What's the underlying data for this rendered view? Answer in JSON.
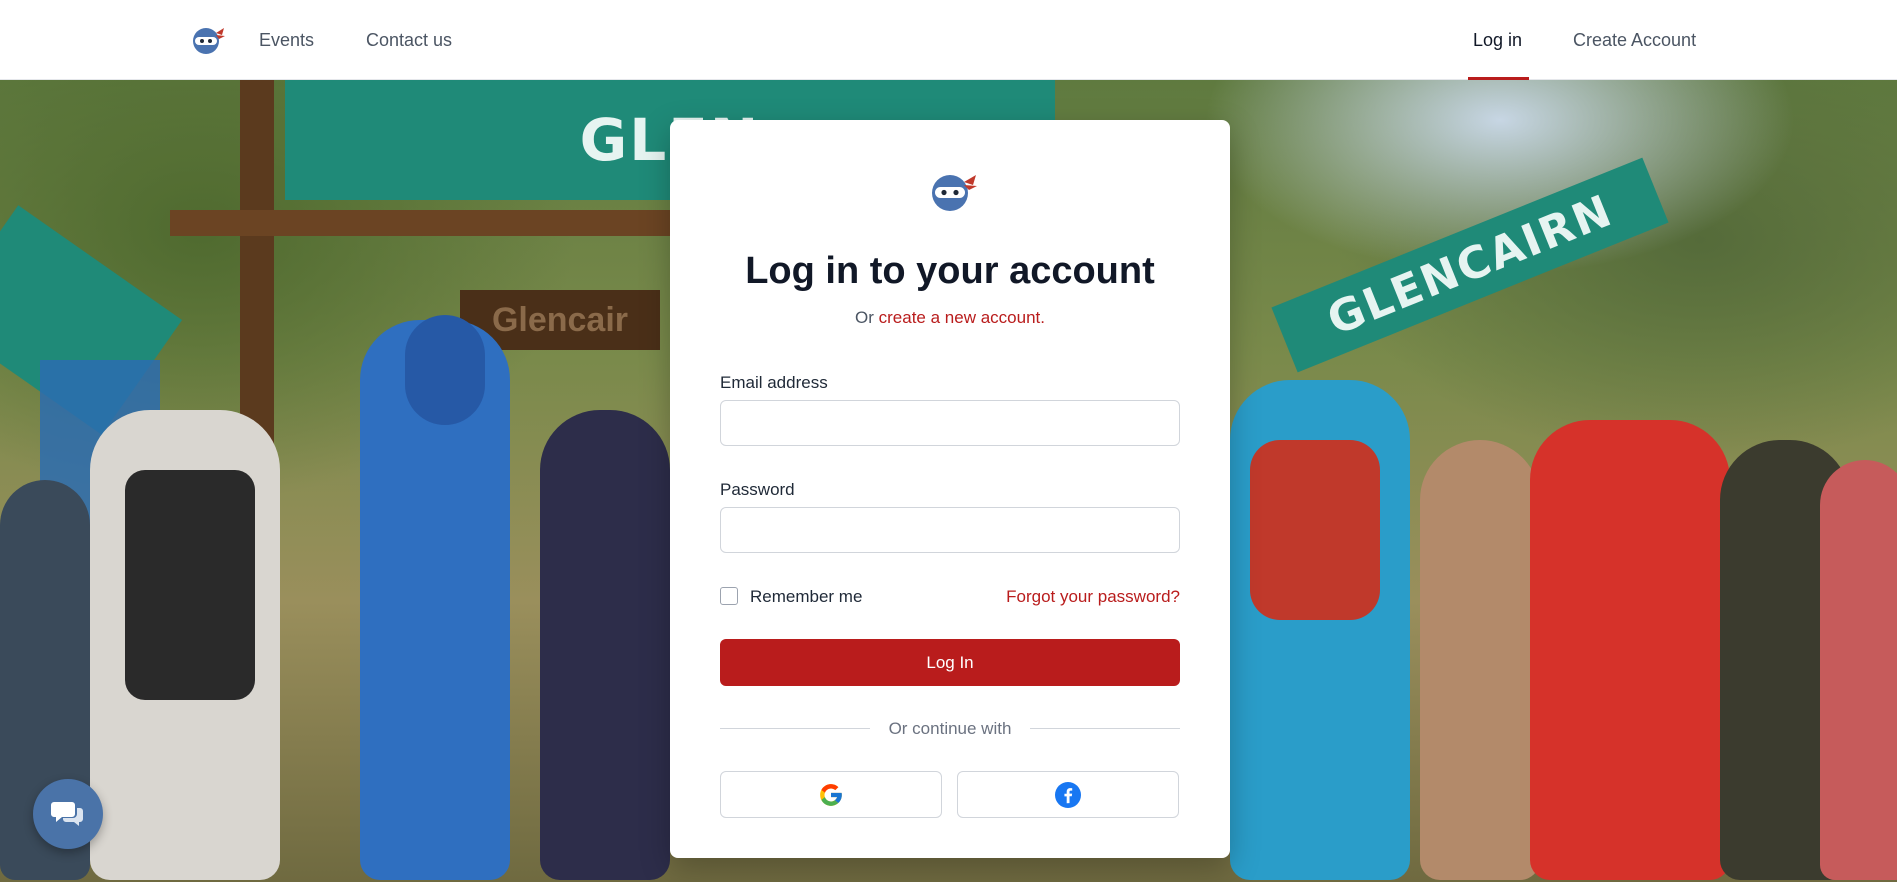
{
  "nav": {
    "logo_icon": "ninja-mascot-icon",
    "links": {
      "events": "Events",
      "contact": "Contact us"
    },
    "right": {
      "login": "Log in",
      "create_account": "Create Account"
    },
    "active": "Log in"
  },
  "background": {
    "banners": {
      "top": "GLEN",
      "right": "GLENCAIRN",
      "sign": "Glencair"
    }
  },
  "login": {
    "title": "Log in to your account",
    "subtitle_prefix": "Or ",
    "subtitle_link": "create a new account.",
    "email_label": "Email address",
    "email_value": "",
    "password_label": "Password",
    "password_value": "",
    "remember_label": "Remember me",
    "remember_checked": false,
    "forgot_link": "Forgot your password?",
    "submit_label": "Log In",
    "divider_text": "Or continue with",
    "social": [
      {
        "provider": "Google",
        "icon": "google-icon"
      },
      {
        "provider": "Facebook",
        "icon": "facebook-icon"
      }
    ]
  },
  "chat": {
    "icon": "chat-icon"
  },
  "colors": {
    "accent": "#b91c1c",
    "nav_active_bar": "#b91c1c",
    "chat_bubble": "#4a73a8",
    "facebook_blue": "#1877f2"
  }
}
